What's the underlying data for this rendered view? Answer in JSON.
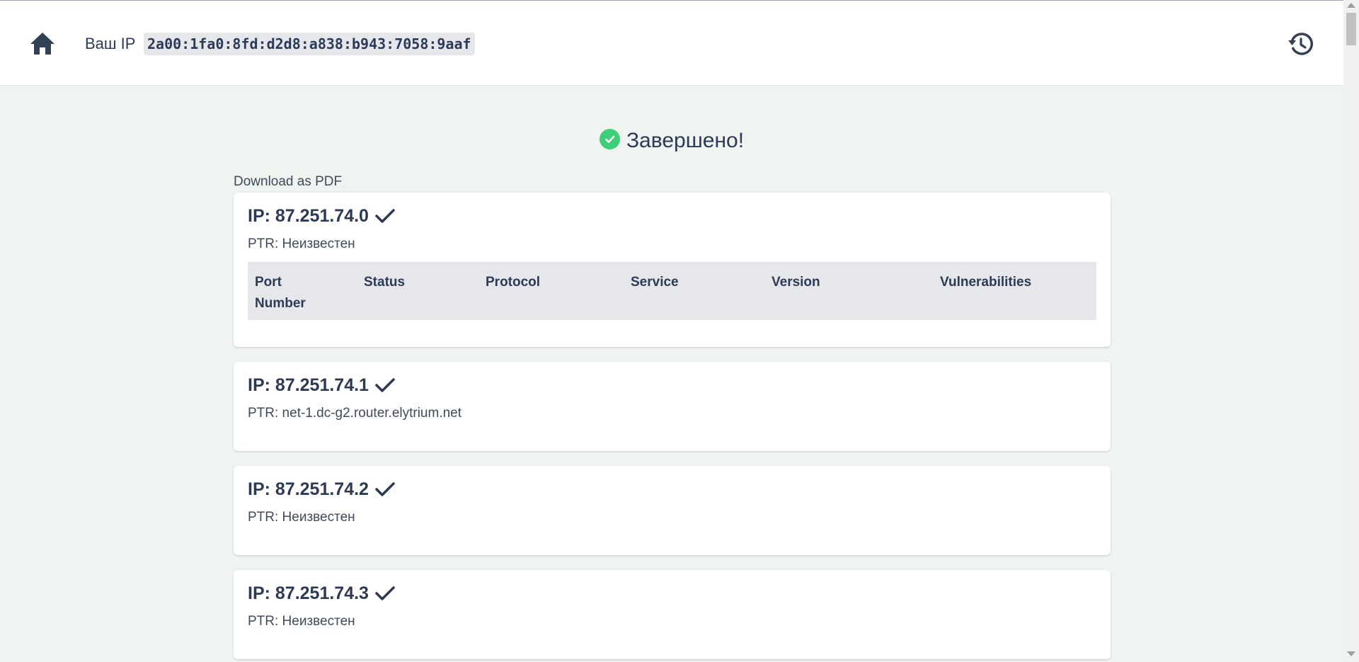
{
  "header": {
    "ip_label": "Ваш IP",
    "ip_value": "2a00:1fa0:8fd:d2d8:a838:b943:7058:9aaf",
    "home_icon": "home-icon",
    "history_icon": "history-icon"
  },
  "status": {
    "text": "Завершено!",
    "icon": "check-circle-icon",
    "color": "#3ecf79"
  },
  "download_label": "Download as PDF",
  "table_headers": [
    "Port\nNumber",
    "Status",
    "Protocol",
    "Service",
    "Version",
    "Vulnerabilities"
  ],
  "hosts": [
    {
      "title": "IP: 87.251.74.0",
      "ptr": "PTR: Неизвестен"
    },
    {
      "title": "IP: 87.251.74.1",
      "ptr": "PTR: net-1.dc-g2.router.elytrium.net"
    },
    {
      "title": "IP: 87.251.74.2",
      "ptr": "PTR: Неизвестен"
    },
    {
      "title": "IP: 87.251.74.3",
      "ptr": "PTR: Неизвестен"
    }
  ],
  "colors": {
    "text_primary": "#2d3a55",
    "background": "#f0f4f1",
    "table_header_bg": "#e5e7eb"
  }
}
